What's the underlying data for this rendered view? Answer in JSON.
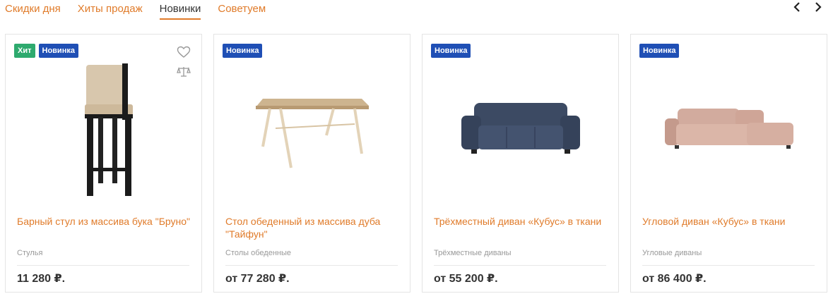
{
  "tabs": [
    {
      "label": "Скидки дня"
    },
    {
      "label": "Хиты продаж"
    },
    {
      "label": "Новинки"
    },
    {
      "label": "Советуем"
    }
  ],
  "active_tab": "Новинки",
  "nav": {
    "prev_icon": "chevron-left-icon",
    "next_icon": "chevron-right-icon"
  },
  "colors": {
    "accent": "#e07b2a",
    "badge_hit": "#2eaa6e",
    "badge_new": "#1f4fb5"
  },
  "products": [
    {
      "badges": [
        "Хит",
        "Новинка"
      ],
      "title": "Барный стул из массива бука \"Бруно\"",
      "category": "Стулья",
      "price": "11 280 ₽."
    },
    {
      "badges": [
        "Новинка"
      ],
      "title": "Стол обеденный из массива дуба \"Тайфун\"",
      "category": "Столы обеденные",
      "price": "от 77 280 ₽."
    },
    {
      "badges": [
        "Новинка"
      ],
      "title": "Трёхместный диван «Кубус» в ткани",
      "category": "Трёхместные диваны",
      "price": "от 55 200 ₽."
    },
    {
      "badges": [
        "Новинка"
      ],
      "title": "Угловой диван «Кубус» в ткани",
      "category": "Угловые диваны",
      "price": "от 86 400 ₽."
    }
  ]
}
